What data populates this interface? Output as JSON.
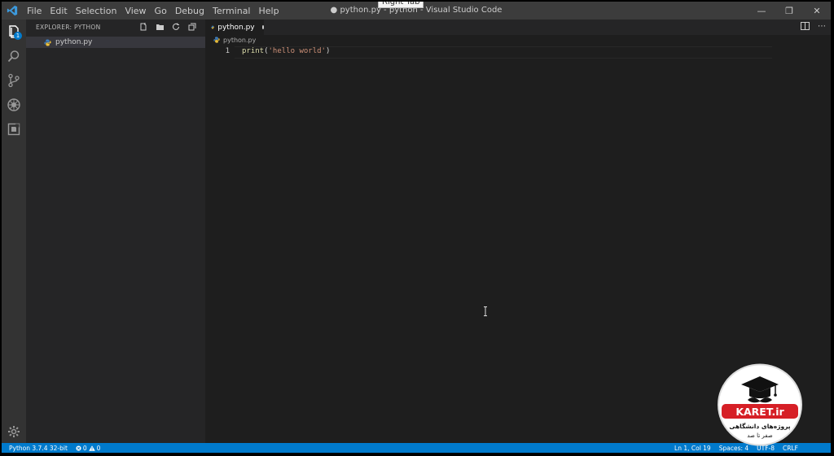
{
  "titlebar": {
    "menu": [
      "File",
      "Edit",
      "Selection",
      "View",
      "Go",
      "Debug",
      "Terminal",
      "Help"
    ],
    "window_title": "● python.py - python - Visual Studio Code",
    "tooltip": "Right Tab"
  },
  "activity": {
    "explorer_badge": "1"
  },
  "sidebar": {
    "header": "EXPLORER: PYTHON",
    "files": [
      "python.py"
    ]
  },
  "editor": {
    "tab_label": "python.py",
    "breadcrumb": "python.py",
    "line_number": "1",
    "code_fn": "print",
    "code_open": "(",
    "code_str": "'hello world'",
    "code_close": ")"
  },
  "statusbar": {
    "interpreter": "Python 3.7.4 32-bit",
    "errors": "0",
    "warnings": "0",
    "position": "Ln 1, Col 19",
    "spaces": "Spaces: 4",
    "encoding": "UTF-8",
    "eol": "CRLF"
  },
  "watermark": {
    "brand": "KARET.ir",
    "tagline_1": "پروژه‌های دانشگاهی",
    "tagline_2": "صفر تا صد"
  },
  "colors": {
    "accent": "#007acc",
    "editor_bg": "#1e1e1e",
    "sidebar_bg": "#252526",
    "activity_bg": "#333333"
  }
}
